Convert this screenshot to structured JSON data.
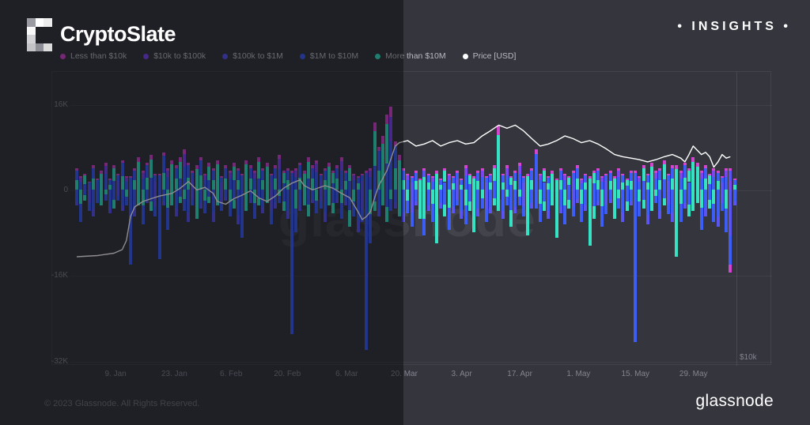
{
  "header": {
    "title": "CryptoSlate",
    "insights": "• INSIGHTS •",
    "logo_cells": [
      [
        "#9a9aa2",
        "#fdfdfd",
        "#ececec"
      ],
      [
        "#f8f8f8",
        null,
        null
      ],
      [
        "#d2d2d6",
        null,
        null
      ],
      [
        "#c4c4c8",
        "#8e8e96",
        "#dcdcdc"
      ]
    ]
  },
  "footer": {
    "copyright": "© 2023 Glassnode. All Rights Reserved.",
    "brand": "glassnode"
  },
  "chart_data": {
    "type": "stacked-bar+line",
    "title": "",
    "watermark": "glassnode",
    "units": "entity net flows, thousands (K); bar values = [positive_K, negative_K, composition_index]",
    "colors": {
      "magenta": "#d445cf",
      "purple": "#7b46f0",
      "indigo": "#5a55f2",
      "blue": "#3c5ef6",
      "teal": "#36e2c4",
      "price": "#ffffff"
    },
    "legend": [
      {
        "label": "Less than $10k",
        "color_key": "magenta"
      },
      {
        "label": "$10k to $100k",
        "color_key": "purple"
      },
      {
        "label": "$100k to $1M",
        "color_key": "indigo"
      },
      {
        "label": "$1M to $10M",
        "color_key": "blue"
      },
      {
        "label": "More than $10M",
        "color_key": "teal"
      },
      {
        "label": "Price [USD]",
        "color_key": "price"
      }
    ],
    "y_axis": {
      "ticks": [
        {
          "label": "16K",
          "value": 16000
        },
        {
          "label": "0",
          "value": 0
        },
        {
          "label": "-16K",
          "value": -16000
        },
        {
          "label": "-32K",
          "value": -32000
        }
      ],
      "grid": true
    },
    "right_axis": {
      "tick": "$10k",
      "value": 10000,
      "scale": "log"
    },
    "x_axis": [
      {
        "label": "9. Jan",
        "fx": 0.06
      },
      {
        "label": "23. Jan",
        "fx": 0.149
      },
      {
        "label": "6. Feb",
        "fx": 0.235
      },
      {
        "label": "20. Feb",
        "fx": 0.32
      },
      {
        "label": "6. Mar",
        "fx": 0.41
      },
      {
        "label": "20. Mar",
        "fx": 0.497
      },
      {
        "label": "3. Apr",
        "fx": 0.584
      },
      {
        "label": "17. Apr",
        "fx": 0.672
      },
      {
        "label": "1. May",
        "fx": 0.761
      },
      {
        "label": "15. May",
        "fx": 0.847
      },
      {
        "label": "29. May",
        "fx": 0.935
      }
    ],
    "compositions": [
      {
        "pos": [
          [
            "teal",
            0.45
          ],
          [
            "blue",
            0.45
          ],
          [
            "magenta",
            0.1
          ]
        ],
        "neg": [
          [
            "blue",
            0.72
          ],
          [
            "indigo",
            0.28
          ]
        ]
      },
      {
        "pos": [
          [
            "blue",
            0.58
          ],
          [
            "purple",
            0.3
          ],
          [
            "magenta",
            0.12
          ]
        ],
        "neg": [
          [
            "teal",
            0.45
          ],
          [
            "blue",
            0.55
          ]
        ]
      },
      {
        "pos": [
          [
            "teal",
            0.85
          ],
          [
            "magenta",
            0.15
          ]
        ],
        "neg": [
          [
            "teal",
            1.0
          ]
        ]
      },
      {
        "pos": [
          [
            "indigo",
            0.55
          ],
          [
            "blue",
            0.33
          ],
          [
            "magenta",
            0.12
          ]
        ],
        "neg": [
          [
            "indigo",
            0.62
          ],
          [
            "blue",
            0.38
          ]
        ]
      },
      {
        "pos": [
          [
            "blue",
            0.88
          ],
          [
            "magenta",
            0.12
          ]
        ],
        "neg": [
          [
            "blue",
            1.0
          ]
        ]
      },
      {
        "pos": [
          [
            "blue",
            0.35
          ],
          [
            "teal",
            0.52
          ],
          [
            "magenta",
            0.13
          ]
        ],
        "neg": [
          [
            "blue",
            0.55
          ],
          [
            "teal",
            0.45
          ]
        ]
      },
      {
        "pos": [
          [
            "purple",
            0.4
          ],
          [
            "indigo",
            0.48
          ],
          [
            "magenta",
            0.12
          ]
        ],
        "neg": [
          [
            "indigo",
            0.55
          ],
          [
            "blue",
            0.35
          ],
          [
            "magenta",
            0.1
          ]
        ]
      },
      {
        "pos": [
          [
            "teal",
            0.6
          ],
          [
            "indigo",
            0.28
          ],
          [
            "magenta",
            0.12
          ]
        ],
        "neg": [
          [
            "teal",
            0.65
          ],
          [
            "blue",
            0.35
          ]
        ]
      }
    ],
    "bars": [
      [
        4,
        3,
        0
      ],
      [
        2.5,
        6,
        1
      ],
      [
        3,
        2,
        5
      ],
      [
        1.5,
        4,
        3
      ],
      [
        4.5,
        5,
        0
      ],
      [
        2,
        2.5,
        4
      ],
      [
        3.5,
        3,
        2
      ],
      [
        5,
        2,
        1
      ],
      [
        2,
        4.5,
        0
      ],
      [
        4.5,
        3.5,
        5
      ],
      [
        3,
        2,
        3
      ],
      [
        5.5,
        4,
        0
      ],
      [
        2.5,
        3,
        1
      ],
      [
        2.5,
        14,
        4
      ],
      [
        4,
        5,
        0
      ],
      [
        6,
        3,
        2
      ],
      [
        3.5,
        6.5,
        1
      ],
      [
        5,
        2.5,
        0
      ],
      [
        6.5,
        4,
        5
      ],
      [
        3,
        5,
        3
      ],
      [
        3,
        13,
        4
      ],
      [
        7,
        3,
        0
      ],
      [
        4,
        7.5,
        1
      ],
      [
        5.5,
        3,
        2
      ],
      [
        4.5,
        5,
        0
      ],
      [
        6,
        2.5,
        5
      ],
      [
        7.5,
        4,
        1
      ],
      [
        5,
        6,
        0
      ],
      [
        3.5,
        3,
        3
      ],
      [
        4.5,
        5.5,
        2
      ],
      [
        6,
        3.5,
        0
      ],
      [
        3,
        4.5,
        1
      ],
      [
        5,
        2.5,
        5
      ],
      [
        4,
        6,
        0
      ],
      [
        5.5,
        3,
        2
      ],
      [
        2.5,
        4,
        3
      ],
      [
        4.5,
        2,
        0
      ],
      [
        3.5,
        5,
        1
      ],
      [
        5,
        3.5,
        5
      ],
      [
        4,
        6.5,
        0
      ],
      [
        3,
        9,
        4
      ],
      [
        5.5,
        4,
        2
      ],
      [
        4.5,
        2.5,
        0
      ],
      [
        3.5,
        5.5,
        1
      ],
      [
        6,
        3,
        5
      ],
      [
        4,
        4.5,
        0
      ],
      [
        5,
        2.5,
        2
      ],
      [
        3,
        6.5,
        3
      ],
      [
        4.5,
        3.5,
        0
      ],
      [
        6.5,
        2.5,
        1
      ],
      [
        3.5,
        4,
        5
      ],
      [
        4,
        5.5,
        0
      ],
      [
        3.5,
        27,
        4
      ],
      [
        4,
        8,
        1
      ],
      [
        5,
        4,
        0
      ],
      [
        3.5,
        3,
        2
      ],
      [
        6,
        5,
        5
      ],
      [
        4.5,
        2.5,
        0
      ],
      [
        5.5,
        4.5,
        1
      ],
      [
        3,
        3.5,
        3
      ],
      [
        4,
        6,
        0
      ],
      [
        5,
        3,
        2
      ],
      [
        3.5,
        4.5,
        5
      ],
      [
        4.5,
        2.5,
        0
      ],
      [
        6,
        5.5,
        1
      ],
      [
        3.5,
        3,
        0
      ],
      [
        4.5,
        7,
        5
      ],
      [
        3,
        5,
        1
      ],
      [
        2.5,
        8,
        0
      ],
      [
        3,
        6,
        3
      ],
      [
        3.5,
        30,
        4
      ],
      [
        4,
        10,
        1
      ],
      [
        12.5,
        4,
        5
      ],
      [
        8,
        5,
        0
      ],
      [
        10,
        3,
        2
      ],
      [
        14,
        6,
        5
      ],
      [
        15.5,
        4,
        1
      ],
      [
        9,
        3.5,
        0
      ],
      [
        6.5,
        5,
        2
      ],
      [
        4,
        6,
        0
      ],
      [
        3,
        4.5,
        1
      ],
      [
        2.5,
        7,
        3
      ],
      [
        3.5,
        3,
        0
      ],
      [
        2,
        5.5,
        2
      ],
      [
        4,
        8.5,
        7
      ],
      [
        3,
        4,
        0
      ],
      [
        2.5,
        6,
        1
      ],
      [
        3.5,
        10,
        2
      ],
      [
        2,
        3.5,
        0
      ],
      [
        4,
        5,
        5
      ],
      [
        3,
        7.5,
        1
      ],
      [
        2.5,
        4.5,
        0
      ],
      [
        3.5,
        3,
        3
      ],
      [
        2,
        5.5,
        0
      ],
      [
        4.5,
        6.5,
        1
      ],
      [
        3,
        4,
        5
      ],
      [
        2.5,
        8,
        2
      ],
      [
        3.5,
        5,
        0
      ],
      [
        4,
        3.5,
        1
      ],
      [
        2.5,
        6,
        3
      ],
      [
        3,
        4.5,
        0
      ],
      [
        4.5,
        3,
        5
      ],
      [
        12,
        4,
        2
      ],
      [
        3,
        5.5,
        0
      ],
      [
        4.5,
        3,
        1
      ],
      [
        2.5,
        7,
        5
      ],
      [
        3.5,
        4.5,
        0
      ],
      [
        5,
        3,
        1
      ],
      [
        2.5,
        5,
        3
      ],
      [
        3,
        8.5,
        2
      ],
      [
        4,
        3.5,
        0
      ],
      [
        7.5,
        3.5,
        4
      ],
      [
        3,
        6,
        1
      ],
      [
        4,
        4,
        5
      ],
      [
        2.5,
        5.5,
        0
      ],
      [
        3.5,
        3,
        2
      ],
      [
        2,
        9,
        2
      ],
      [
        4,
        4.5,
        0
      ],
      [
        3,
        6.5,
        1
      ],
      [
        2.5,
        3.5,
        5
      ],
      [
        3.5,
        5,
        3
      ],
      [
        4.5,
        2.5,
        0
      ],
      [
        2,
        6,
        1
      ],
      [
        3,
        4,
        0
      ],
      [
        2.5,
        10.5,
        2
      ],
      [
        3.5,
        5.5,
        5
      ],
      [
        4,
        3,
        0
      ],
      [
        2.5,
        7,
        1
      ],
      [
        3,
        4.5,
        3
      ],
      [
        3.5,
        2.5,
        0
      ],
      [
        2.5,
        5.5,
        2
      ],
      [
        4,
        3.5,
        1
      ],
      [
        3,
        6,
        0
      ],
      [
        2,
        4,
        5
      ],
      [
        3.5,
        3,
        0
      ],
      [
        3.5,
        28.5,
        4
      ],
      [
        2.5,
        5,
        1
      ],
      [
        4.5,
        3.5,
        5
      ],
      [
        3,
        6.5,
        0
      ],
      [
        5,
        4,
        2
      ],
      [
        3.5,
        2.5,
        1
      ],
      [
        4,
        5.5,
        0
      ],
      [
        5.5,
        3,
        5
      ],
      [
        3,
        4.5,
        3
      ],
      [
        4.5,
        6,
        0
      ],
      [
        4.5,
        12.5,
        2
      ],
      [
        3.5,
        6,
        1
      ],
      [
        5,
        3.5,
        0
      ],
      [
        4,
        5,
        5
      ],
      [
        6,
        4,
        2
      ],
      [
        5,
        2.5,
        2
      ],
      [
        3.5,
        7.5,
        1
      ],
      [
        4.5,
        5,
        0
      ],
      [
        3,
        3.5,
        5
      ],
      [
        4,
        6,
        1
      ],
      [
        3.5,
        7,
        0
      ],
      [
        2.5,
        4,
        3
      ],
      [
        4,
        8,
        1
      ],
      [
        4,
        15.5,
        6
      ],
      [
        2,
        3,
        0
      ]
    ],
    "price_line": [
      [
        0,
        16600
      ],
      [
        5,
        16700
      ],
      [
        9,
        16900
      ],
      [
        11,
        17200
      ],
      [
        12,
        18000
      ],
      [
        13,
        20300
      ],
      [
        14,
        21300
      ],
      [
        16,
        21900
      ],
      [
        18,
        22200
      ],
      [
        20,
        22500
      ],
      [
        23,
        22800
      ],
      [
        25,
        23400
      ],
      [
        27,
        24200
      ],
      [
        29,
        23200
      ],
      [
        31,
        23500
      ],
      [
        33,
        22800
      ],
      [
        34,
        21900
      ],
      [
        36,
        21600
      ],
      [
        38,
        22200
      ],
      [
        40,
        22600
      ],
      [
        42,
        23100
      ],
      [
        44,
        22300
      ],
      [
        46,
        21900
      ],
      [
        48,
        22500
      ],
      [
        50,
        23400
      ],
      [
        52,
        24000
      ],
      [
        54,
        24400
      ],
      [
        55,
        23700
      ],
      [
        57,
        23200
      ],
      [
        60,
        23700
      ],
      [
        62,
        23400
      ],
      [
        64,
        22800
      ],
      [
        66,
        22300
      ],
      [
        68,
        20800
      ],
      [
        69,
        20000
      ],
      [
        70,
        20300
      ],
      [
        71,
        20800
      ],
      [
        72,
        22300
      ],
      [
        73,
        23700
      ],
      [
        74,
        24600
      ],
      [
        75,
        25600
      ],
      [
        76,
        27200
      ],
      [
        77,
        28900
      ],
      [
        78,
        29400
      ],
      [
        80,
        29700
      ],
      [
        82,
        28900
      ],
      [
        84,
        29200
      ],
      [
        86,
        29700
      ],
      [
        88,
        28900
      ],
      [
        90,
        29400
      ],
      [
        92,
        29700
      ],
      [
        94,
        29200
      ],
      [
        96,
        29400
      ],
      [
        98,
        30400
      ],
      [
        100,
        31200
      ],
      [
        102,
        32100
      ],
      [
        104,
        31600
      ],
      [
        106,
        32100
      ],
      [
        108,
        31200
      ],
      [
        110,
        30000
      ],
      [
        112,
        28900
      ],
      [
        114,
        29200
      ],
      [
        116,
        29700
      ],
      [
        118,
        30400
      ],
      [
        120,
        30000
      ],
      [
        122,
        29400
      ],
      [
        124,
        29700
      ],
      [
        126,
        29200
      ],
      [
        128,
        28500
      ],
      [
        130,
        27700
      ],
      [
        132,
        27400
      ],
      [
        134,
        27200
      ],
      [
        136,
        27000
      ],
      [
        138,
        26700
      ],
      [
        140,
        27000
      ],
      [
        142,
        27400
      ],
      [
        144,
        27700
      ],
      [
        146,
        27200
      ],
      [
        147,
        26700
      ],
      [
        148,
        27700
      ],
      [
        149,
        28900
      ],
      [
        150,
        28300
      ],
      [
        151,
        27700
      ],
      [
        152,
        28000
      ],
      [
        153,
        27400
      ],
      [
        154,
        26000
      ],
      [
        155,
        26700
      ],
      [
        156,
        27700
      ],
      [
        157,
        27200
      ],
      [
        158,
        27400
      ]
    ]
  }
}
